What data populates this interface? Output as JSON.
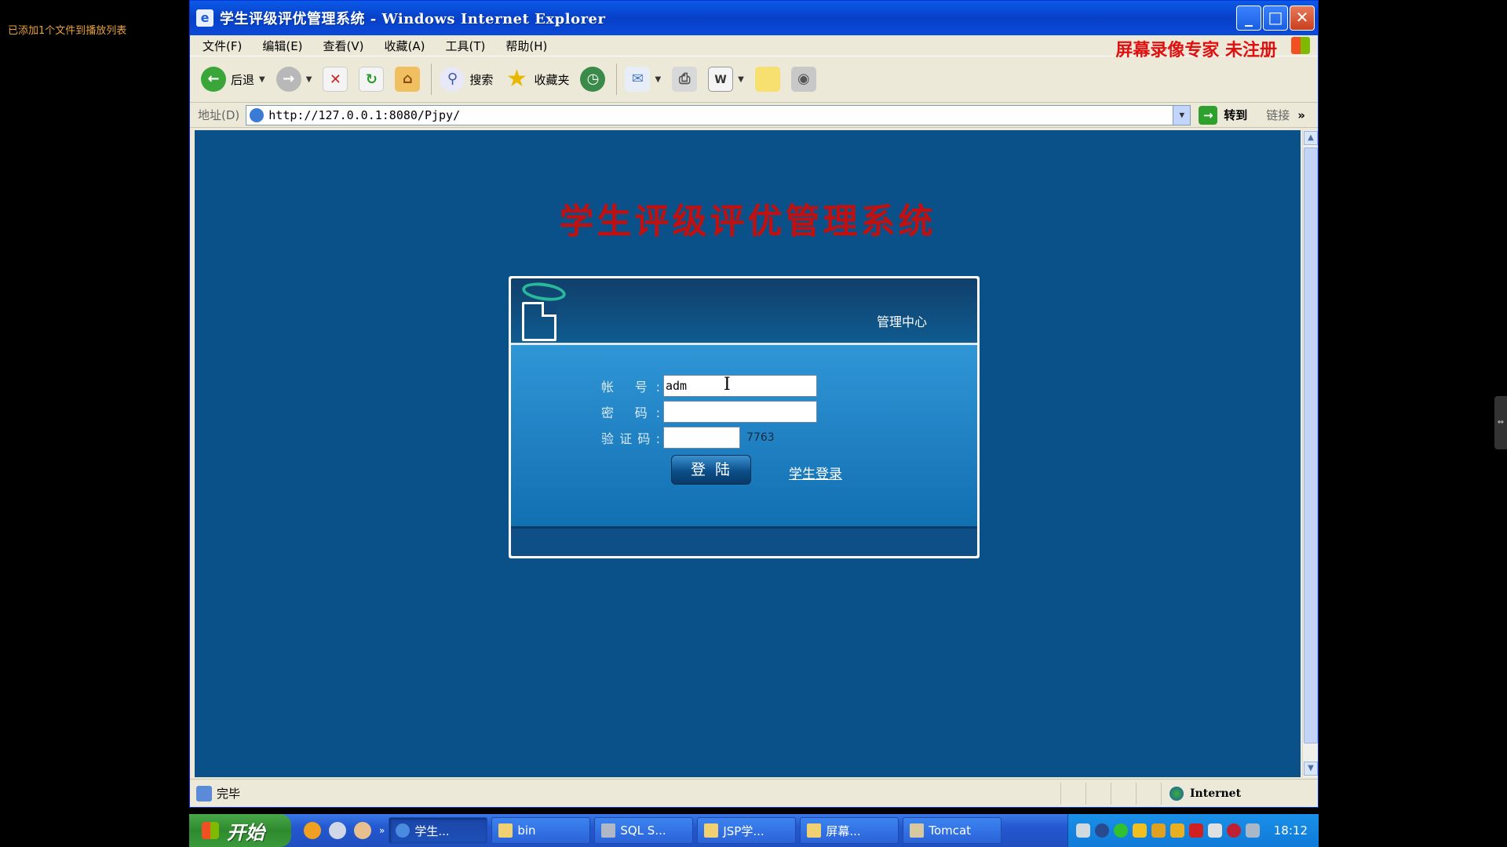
{
  "player_note": "已添加1个文件到播放列表",
  "window": {
    "title": "学生评级评优管理系统 - Windows Internet Explorer",
    "buttons": {
      "minimize": "_",
      "maximize": "□",
      "close": "✕"
    }
  },
  "menu": [
    "文件(F)",
    "编辑(E)",
    "查看(V)",
    "收藏(A)",
    "工具(T)",
    "帮助(H)"
  ],
  "watermark": "屏幕录像专家  未注册",
  "toolbar": {
    "back": "后退",
    "search": "搜索",
    "favorites": "收藏夹"
  },
  "address": {
    "label": "地址(D)",
    "url": "http://127.0.0.1:8080/Pjpy/",
    "go": "转到",
    "links": "链接",
    "more": "»"
  },
  "page": {
    "title": "学生评级评优管理系统",
    "panel_header": "管理中心",
    "fields": {
      "account_label": "帐 号:",
      "account_value": "adm",
      "password_label": "密 码:",
      "captcha_label": "验证码:",
      "captcha_code": "7763"
    },
    "login_button": "登陆",
    "student_link": "学生登录"
  },
  "status": {
    "text": "完毕",
    "zone": "Internet"
  },
  "taskbar": {
    "start": "开始",
    "tasks": [
      "学生...",
      "bin",
      "SQL S...",
      "JSP学...",
      "屏幕...",
      "Tomcat"
    ],
    "clock": "18:12"
  },
  "colors": {
    "page_bg": "#0b5189",
    "title_red": "#c01010",
    "watermark_red": "#e01010",
    "titlebar_blue": "#0a5ae8"
  }
}
